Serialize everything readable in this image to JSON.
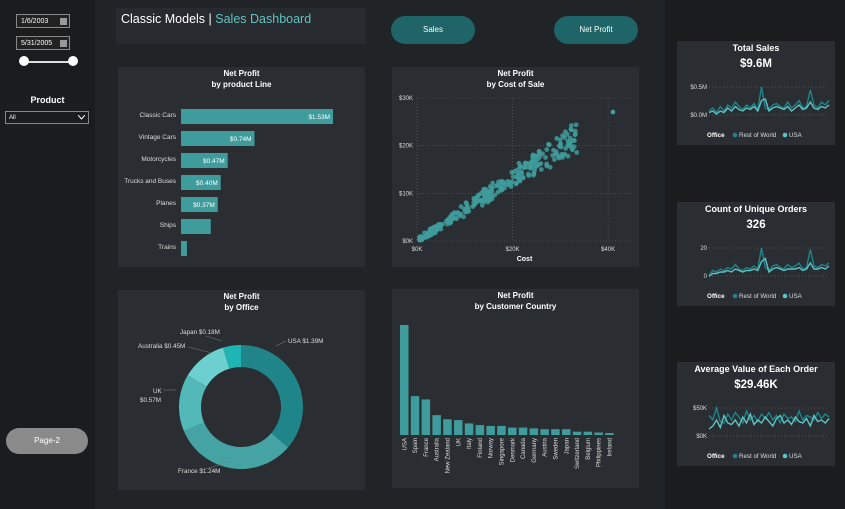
{
  "filters": {
    "start_date": "1/6/2003",
    "end_date": "5/31/2005",
    "product_label": "Product",
    "product_value": "All"
  },
  "header": {
    "title_main": "Classic Models",
    "title_sep": " | ",
    "title_accent": "Sales Dashboard"
  },
  "nav": {
    "sales_label": "Sales",
    "net_profit_label": "Net Profit",
    "page2_label": "Page-2"
  },
  "profit_by_line": {
    "title1": "Net Profit",
    "title2": "by product Line",
    "rows": [
      {
        "label": "Classic Cars",
        "value_label": "$1.53M"
      },
      {
        "label": "Vintage Cars",
        "value_label": "$0.74M"
      },
      {
        "label": "Motorcycles",
        "value_label": "$0.47M"
      },
      {
        "label": "Trucks and Buses",
        "value_label": "$0.40M"
      },
      {
        "label": "Planes",
        "value_label": "$0.37M"
      },
      {
        "label": "Ships",
        "value_label": ""
      },
      {
        "label": "Trains",
        "value_label": ""
      }
    ]
  },
  "profit_by_cost": {
    "title1": "Net Profit",
    "title2": "by Cost of Sale",
    "xlabel": "Cost",
    "yticks": [
      "$0K",
      "$10K",
      "$20K",
      "$30K"
    ],
    "xticks": [
      "$0K",
      "$20K",
      "$40K"
    ]
  },
  "profit_by_office": {
    "title1": "Net Profit",
    "title2": "by Office",
    "slices": [
      {
        "label": "USA $1.39M"
      },
      {
        "label": "France $1.24M"
      },
      {
        "label": "UK"
      },
      {
        "label": "$0.57M"
      },
      {
        "label": "Australia $0.45M"
      },
      {
        "label": "Japan $0.18M"
      }
    ]
  },
  "profit_by_country": {
    "title1": "Net Profit",
    "title2": "by Customer Country"
  },
  "kpis": [
    {
      "title": "Total Sales",
      "value": "$9.6M",
      "yticks": [
        "$0.5M",
        "$0.0M"
      ]
    },
    {
      "title": "Count of Unique Orders",
      "value": "326",
      "yticks": [
        "20",
        "0"
      ]
    },
    {
      "title": "Average Value of Each Order",
      "value": "$29.46K",
      "yticks": [
        "$50K",
        "$0K"
      ]
    }
  ],
  "kpi_legend": {
    "office": "Office",
    "row": "Rest of World",
    "usa": "USA"
  },
  "colors": {
    "accent": "#3f9c9c",
    "dark_teal": "#1f6466",
    "light_teal": "#5fc3c3"
  },
  "chart_data": [
    {
      "type": "bar",
      "title": "Net Profit by product Line",
      "categories": [
        "Classic Cars",
        "Vintage Cars",
        "Motorcycles",
        "Trucks and Buses",
        "Planes",
        "Ships",
        "Trains"
      ],
      "values": [
        1.53,
        0.74,
        0.47,
        0.4,
        0.37,
        0.3,
        0.06
      ]
    },
    {
      "type": "scatter",
      "title": "Net Profit by Cost of Sale",
      "xlabel": "Cost",
      "xlim": [
        0,
        45000
      ],
      "ylim": [
        0,
        30000
      ],
      "trend": {
        "slope": 0.66,
        "x_max": 41000
      }
    },
    {
      "type": "pie",
      "title": "Net Profit by Office",
      "categories": [
        "USA",
        "France",
        "UK",
        "Australia",
        "Japan"
      ],
      "values": [
        1.39,
        1.24,
        0.57,
        0.45,
        0.18
      ]
    },
    {
      "type": "bar",
      "title": "Net Profit by Customer Country",
      "categories": [
        "USA",
        "Spain",
        "France",
        "Australia",
        "New Zealand",
        "UK",
        "Italy",
        "Finland",
        "Norway",
        "Singapore",
        "Denmark",
        "Canada",
        "Germany",
        "Austria",
        "Sweden",
        "Japan",
        "Switzerland",
        "Belgium",
        "Philippines",
        "Ireland"
      ],
      "values": [
        1.33,
        0.47,
        0.43,
        0.24,
        0.19,
        0.18,
        0.14,
        0.12,
        0.11,
        0.11,
        0.09,
        0.09,
        0.08,
        0.07,
        0.07,
        0.07,
        0.04,
        0.04,
        0.03,
        0.02
      ]
    }
  ]
}
